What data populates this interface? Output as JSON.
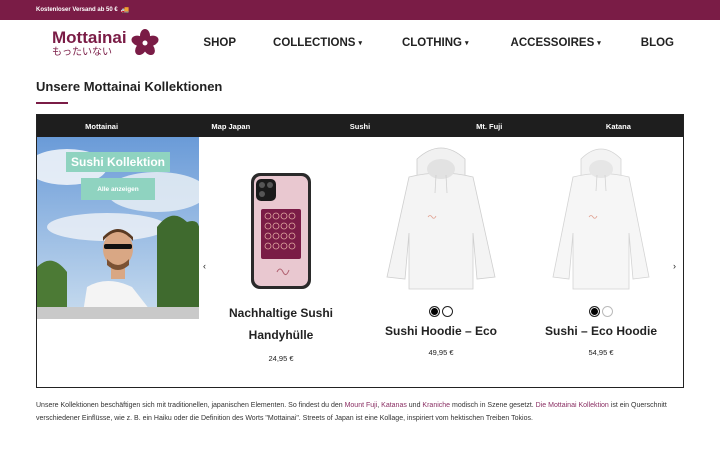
{
  "topbar": {
    "shipping_text": "Kostenloser Versand ab 50 €",
    "truck_icon": "🚚"
  },
  "logo": {
    "name": "Mottainai",
    "subtitle": "もったいない",
    "flower_color": "#7a1c46"
  },
  "nav": {
    "shop": "SHOP",
    "collections": "COLLECTIONS",
    "clothing": "CLOTHING",
    "accessoires": "ACCESSOIRES",
    "blog": "BLOG",
    "chevron": "⌄"
  },
  "section": {
    "title": "Unsere Mottainai Kollektionen"
  },
  "tabs": [
    "Mottainai",
    "Map Japan",
    "Sushi",
    "Mt. Fuji",
    "Katana"
  ],
  "hero": {
    "title": "Sushi Kollektion",
    "button": "Alle anzeigen"
  },
  "carousel": {
    "prev": "‹",
    "next": "›"
  },
  "products": [
    {
      "name_line1": "Nachhaltige Sushi",
      "name_line2": "Handyhülle",
      "price": "24,95 €"
    },
    {
      "name": "Sushi Hoodie – Eco",
      "price": "49,95 €"
    },
    {
      "name": "Sushi – Eco Hoodie",
      "price": "54,95 €"
    }
  ],
  "description": {
    "part1": "Unsere Kollektionen beschäftigen sich mit traditionellen, japanischen Elementen. So findest du den ",
    "link1": "Mount Fuji",
    "part2": ", ",
    "link2": "Katanas",
    "part3": " und ",
    "link3": "Kraniche",
    "part4": " modisch in Szene gesetzt. ",
    "link4": "Die Mottainai Kollektion",
    "part5": " ist ein Querschnitt verschiedener Einflüsse, wie z. B. ein Haiku oder die Definition des Worts \"Mottainai\". Streets of Japan ist eine Kollage, inspiriert vom hektischen Treiben Tokios."
  },
  "colors": {
    "brand": "#7a1c46",
    "accent": "#8fd3c0",
    "tabbar": "#1e1e1e"
  }
}
